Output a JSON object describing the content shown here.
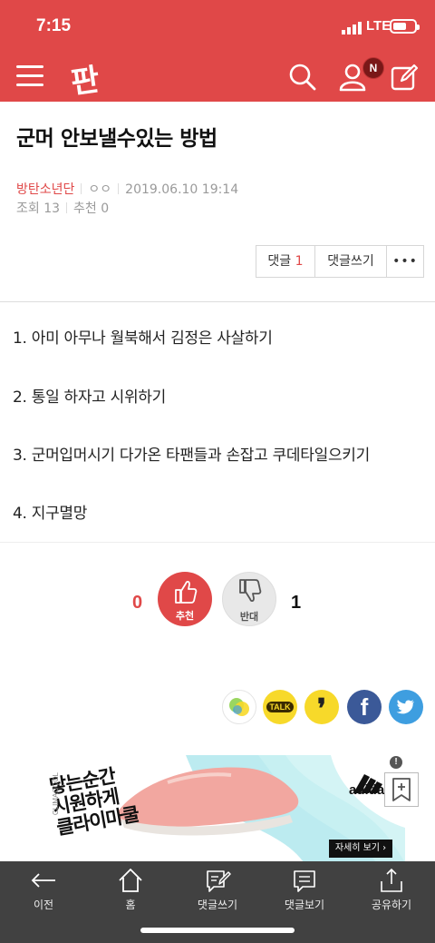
{
  "status": {
    "time": "7:15",
    "network": "LTE"
  },
  "header": {
    "logo": "판",
    "notif_badge": "N"
  },
  "article": {
    "title": "군머 안보낼수있는 방법",
    "author": "방탄소년단",
    "author_sub": "ㅇㅇ",
    "date": "2019.06.10 19:14",
    "views_label": "조회 13",
    "recommend_label": "추천 0"
  },
  "actions": {
    "comments_label": "댓글",
    "comments_count": "1",
    "write_comment_label": "댓글쓰기",
    "more_label": "•••"
  },
  "body": {
    "lines": [
      "1. 아미 아무나 월북해서 김정은 사살하기",
      "2. 통일 하자고 시위하기",
      "3. 군머입머시기 다가온 타팬들과 손잡고 쿠데타일으키기",
      "4. 지구멸망"
    ]
  },
  "vote": {
    "up_count": "0",
    "up_label": "추천",
    "down_label": "반대",
    "down_count": "1"
  },
  "share": {
    "talk_label": "TALK",
    "quote_glyph": "❜",
    "facebook_glyph": "f"
  },
  "ad": {
    "headline_1": "닿는순간",
    "headline_2": "시원하게",
    "headline_3": "클라이마쿨",
    "side_text": "CLIMACOOL",
    "brand": "adidas",
    "cta": "자세히 보기 ›",
    "badge": "!"
  },
  "tabs": [
    {
      "label": "이전",
      "icon": "back-arrow-icon"
    },
    {
      "label": "홈",
      "icon": "home-icon"
    },
    {
      "label": "댓글쓰기",
      "icon": "write-comment-icon"
    },
    {
      "label": "댓글보기",
      "icon": "view-comments-icon"
    },
    {
      "label": "공유하기",
      "icon": "share-icon"
    }
  ],
  "colors": {
    "brand_red": "#e04848",
    "tabbar": "#414141",
    "facebook": "#3b5998",
    "twitter": "#3e9ee0",
    "kakao": "#f7d92a"
  }
}
